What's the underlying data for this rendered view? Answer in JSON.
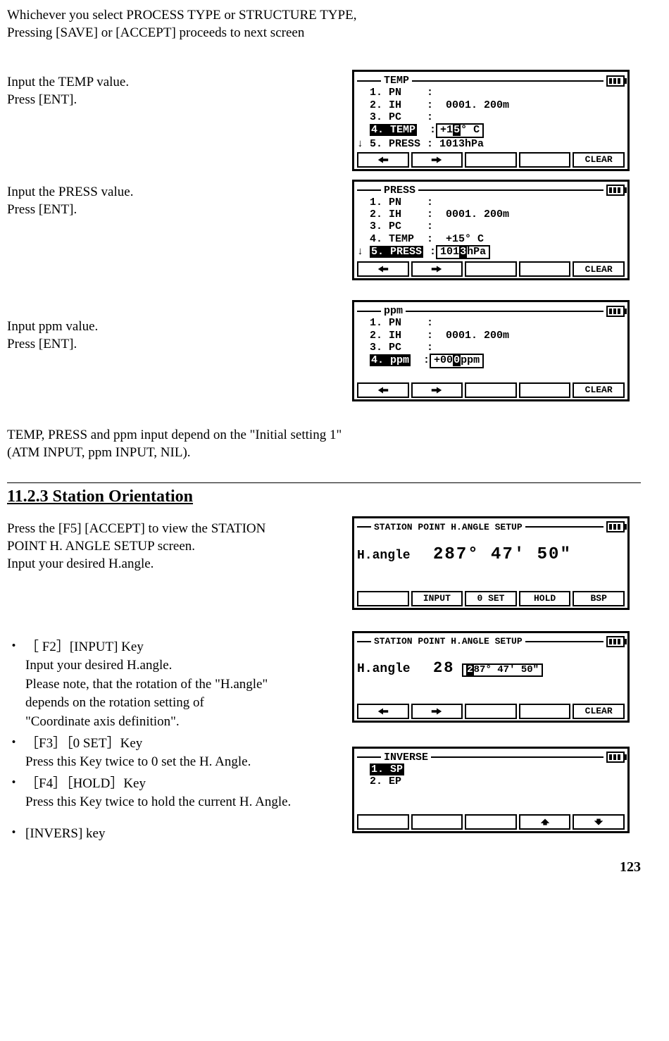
{
  "intro_line1": "Whichever you select PROCESS TYPE or STRUCTURE TYPE,",
  "intro_line2": "Pressing [SAVE] or [ACCEPT] proceeds to next screen",
  "row_temp_txt1": "Input the TEMP value.",
  "row_temp_txt2": "Press [ENT].",
  "row_press_txt1": "Input the PRESS value.",
  "row_press_txt2": "Press [ENT].",
  "row_ppm_txt1": "Input ppm value.",
  "row_ppm_txt2": "Press [ENT].",
  "temp_screen": {
    "title": "TEMP",
    "l1": "  1. PN    :",
    "l2": "  2. IH    :  0001. 200m",
    "l3": "  3. PC    :",
    "l4_label": "4. TEMP",
    "l4_val_pre": "+1",
    "l4_val_cur": "5",
    "l4_val_post": "° C",
    "l5": "↓ 5. PRESS : 1013hPa",
    "sk5": "CLEAR"
  },
  "press_screen": {
    "title": "PRESS",
    "l1": "  1. PN    :",
    "l2": "  2. IH    :  0001. 200m",
    "l3": "  3. PC    :",
    "l4": "  4. TEMP  :  +15° C",
    "l5_label": "5. PRESS",
    "l5_val_pre": "101",
    "l5_val_cur": "3",
    "l5_val_post": "hPa",
    "sk5": "CLEAR"
  },
  "ppm_screen": {
    "title": "ppm",
    "l1": "  1. PN    :",
    "l2": "  2. IH    :  0001. 200m",
    "l3": "  3. PC    :",
    "l4_label": "4. ppm",
    "l4_val_pre": "+00",
    "l4_val_cur": "0",
    "l4_val_post": "ppm",
    "sk5": "CLEAR"
  },
  "mid_note_l1": "TEMP, PRESS and ppm input depend on the \"Initial setting 1\"",
  "mid_note_l2": "(ATM INPUT, ppm INPUT, NIL).",
  "section_heading": "11.2.3 Station Orientation",
  "orient_txt1": "Press the [F5] [ACCEPT] to view the STATION",
  "orient_txt2": "POINT H. ANGLE SETUP screen.",
  "orient_txt3": "Input your desired H.angle.",
  "hangle_screen1": {
    "title": "STATION POINT H.ANGLE SETUP",
    "label": "H.angle",
    "value": "287° 47' 50\"",
    "sk2": "INPUT",
    "sk3": "0 SET",
    "sk4": "HOLD",
    "sk5": "BSP"
  },
  "hangle_screen2": {
    "title": "STATION POINT H.ANGLE SETUP",
    "label": "H.angle",
    "pre": "28",
    "box_cur": "2",
    "box_rest": "87° 47' 50\"",
    "sk5": "CLEAR"
  },
  "inverse_screen": {
    "title": "INVERSE",
    "l1_label": "1. SP",
    "l2": "  2. EP"
  },
  "b1_head": "［ F2］[INPUT] Key",
  "b1_l1": "Input your desired H.angle.",
  "b1_l2": "Please note, that the rotation of the \"H.angle\"",
  "b1_l3": "depends on the rotation setting of",
  "b1_l4": "\"Coordinate axis definition\".",
  "b2_head": " ［F3］［0 SET］Key",
  "b2_l1": "Press this Key twice to 0 set the H. Angle.",
  "b3_head": "［F4］［HOLD］Key",
  "b3_l1": "Press this Key twice to hold the current H. Angle.",
  "b4_head": " [INVERS] key",
  "page_number": "123"
}
